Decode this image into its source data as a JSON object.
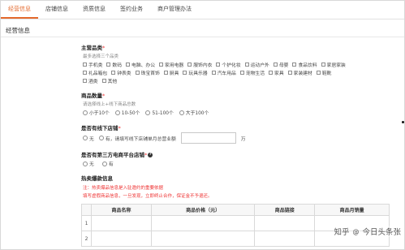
{
  "tabs": [
    {
      "label": "经营信息",
      "active": true
    },
    {
      "label": "店铺信息",
      "active": false
    },
    {
      "label": "资质信息",
      "active": false
    },
    {
      "label": "签约业务",
      "active": false
    },
    {
      "label": "商户管理办法",
      "active": false
    }
  ],
  "section_title": "经营信息",
  "main_category": {
    "label": "主营品类",
    "required_mark": "*",
    "hint": "最多选择三个品类",
    "options_rows": [
      [
        "手机类",
        "数码",
        "电脑、办公",
        "家用电器",
        "服饰内衣",
        "个护化妆",
        "运动户外",
        "母婴",
        "食品饮料",
        "家居家装"
      ],
      [
        "礼品箱包",
        "钟表类",
        "珠宝首饰",
        "厨具",
        "玩具乐器",
        "汽车用品",
        "宠物生活",
        "家具",
        "家装建材",
        "鞋靴"
      ],
      [
        "酒类",
        "其他"
      ]
    ]
  },
  "product_count": {
    "label": "商品数量",
    "required_mark": "*",
    "hint": "请选择线上+线下商品总数",
    "options": [
      "小于10个",
      "10-50个",
      "51-100个",
      "大于100个"
    ]
  },
  "offline_store": {
    "label": "是否有线下店铺",
    "required_mark": "*",
    "options": [
      "无",
      "有，请填写线下店铺单月总营业额"
    ],
    "amount_value": "",
    "unit": "万"
  },
  "third_party_store": {
    "label": "是否有第三方电商平台店铺",
    "required_mark": "*",
    "help_icon": "question-icon",
    "options": [
      "无",
      "有"
    ]
  },
  "hot_products": {
    "label": "热卖爆款信息",
    "warning_line1": "注：热卖爆品信息是入驻邀约的重要依据",
    "warning_line2": "填写虚假商品信息，一旦发现，立即终止合作，保证金不予退还。",
    "columns": [
      "商品名称",
      "商品价格（元）",
      "商品链接",
      "商品月销量"
    ],
    "rows": [
      {
        "index": "1",
        "name": "",
        "price": "",
        "link": "",
        "sales": ""
      },
      {
        "index": "2",
        "name": "",
        "price": "",
        "link": "",
        "sales": ""
      }
    ]
  },
  "watermark": {
    "brand": "知乎",
    "at": "@",
    "author": "今日头条张"
  }
}
